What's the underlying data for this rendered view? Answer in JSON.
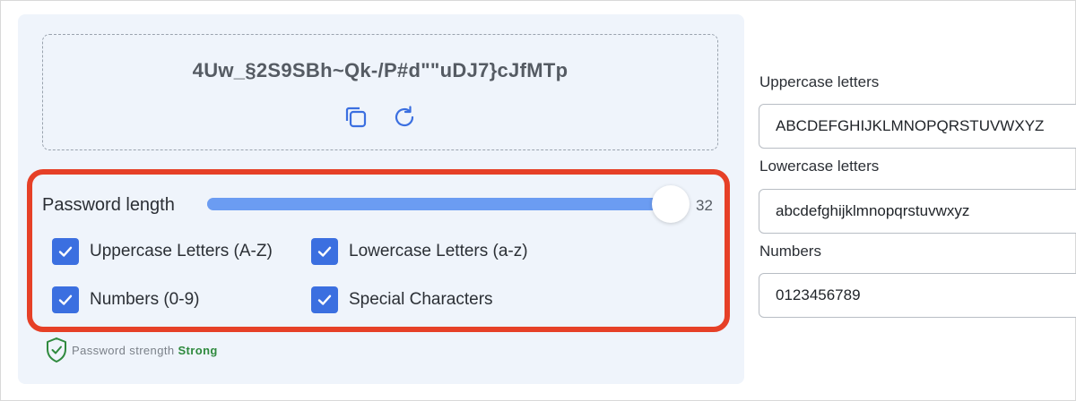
{
  "password": {
    "value": "4Uw_§2S9SBh~Qk-/P#d\"\"uDJ7}cJfMTp",
    "copy_icon": "copy-icon",
    "regenerate_icon": "refresh-icon"
  },
  "length": {
    "label": "Password length",
    "value": "32",
    "slider_fraction": 1.0
  },
  "options": [
    {
      "label": "Uppercase Letters (A-Z)",
      "checked": true
    },
    {
      "label": "Lowercase Letters (a-z)",
      "checked": true
    },
    {
      "label": "Numbers (0-9)",
      "checked": true
    },
    {
      "label": "Special Characters",
      "checked": true
    }
  ],
  "strength": {
    "label": "Password strength",
    "value": "Strong",
    "icon": "shield-check-icon"
  },
  "charsets": {
    "uppercase": {
      "label": "Uppercase letters",
      "value": "ABCDEFGHIJKLMNOPQRSTUVWXYZ"
    },
    "lowercase": {
      "label": "Lowercase letters",
      "value": "abcdefghijklmnopqrstuvwxyz"
    },
    "numbers": {
      "label": "Numbers",
      "value": "0123456789"
    }
  },
  "colors": {
    "accent": "#3b6fe0",
    "slider_fill": "#6b9cf2",
    "highlight": "#e64027",
    "strong": "#2f8a3e",
    "card_bg": "#eff4fb"
  }
}
